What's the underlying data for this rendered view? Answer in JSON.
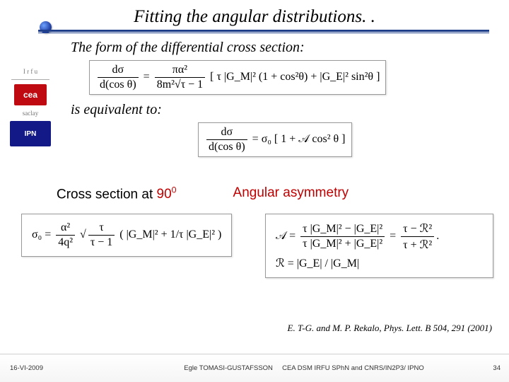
{
  "title": "Fitting the angular distributions. .",
  "line1": "The form of the differential cross section:",
  "eq1": {
    "lhs_num": "dσ",
    "lhs_den": "d(cos θ)",
    "rhs_pref_num": "πα²",
    "rhs_pref_den": "8m²√τ − 1",
    "rhs_bracket": "[ τ |G_M|² (1 + cos²θ) + |G_E|² sin²θ ]"
  },
  "line2": "is equivalent to:",
  "eq2": {
    "lhs_num": "dσ",
    "lhs_den": "d(cos θ)",
    "rhs_sigma": "σ₀",
    "rhs_bracket": "[ 1 + 𝒜 cos² θ ]"
  },
  "sections": {
    "cross": {
      "label": "Cross section at ",
      "exp": "90",
      "exp_sup": "0"
    },
    "asym": {
      "label": "Angular asymmetry"
    }
  },
  "eq_sigma0": {
    "lhs": "σ₀ =",
    "pref_num": "α²",
    "pref_den": "4q²",
    "root_num": "τ",
    "root_den": "τ − 1",
    "paren": "( |G_M|² + 1/τ |G_E|² )"
  },
  "eq_A": {
    "lhs": "𝒜 =",
    "num": "τ |G_M|² − |G_E|²",
    "den": "τ |G_M|² + |G_E|²",
    "num2": "τ − ℛ²",
    "den2": "τ + ℛ²"
  },
  "eq_R": {
    "lhs": "ℛ =",
    "rhs": "|G_E| / |G_M|"
  },
  "reference": "E. T-G. and M. P. Rekalo, Phys. Lett. B 504, 291 (2001)",
  "footer": {
    "date": "16-VI-2009",
    "author": "Egle TOMASI-GUSTAFSSON",
    "affil": "CEA DSM IRFU SPhN and  CNRS/IN2P3/ IPNO",
    "page": "34"
  },
  "logos": {
    "l1": "I r f u",
    "l2": "cea",
    "l3": "saclay",
    "l4": "IPN"
  }
}
